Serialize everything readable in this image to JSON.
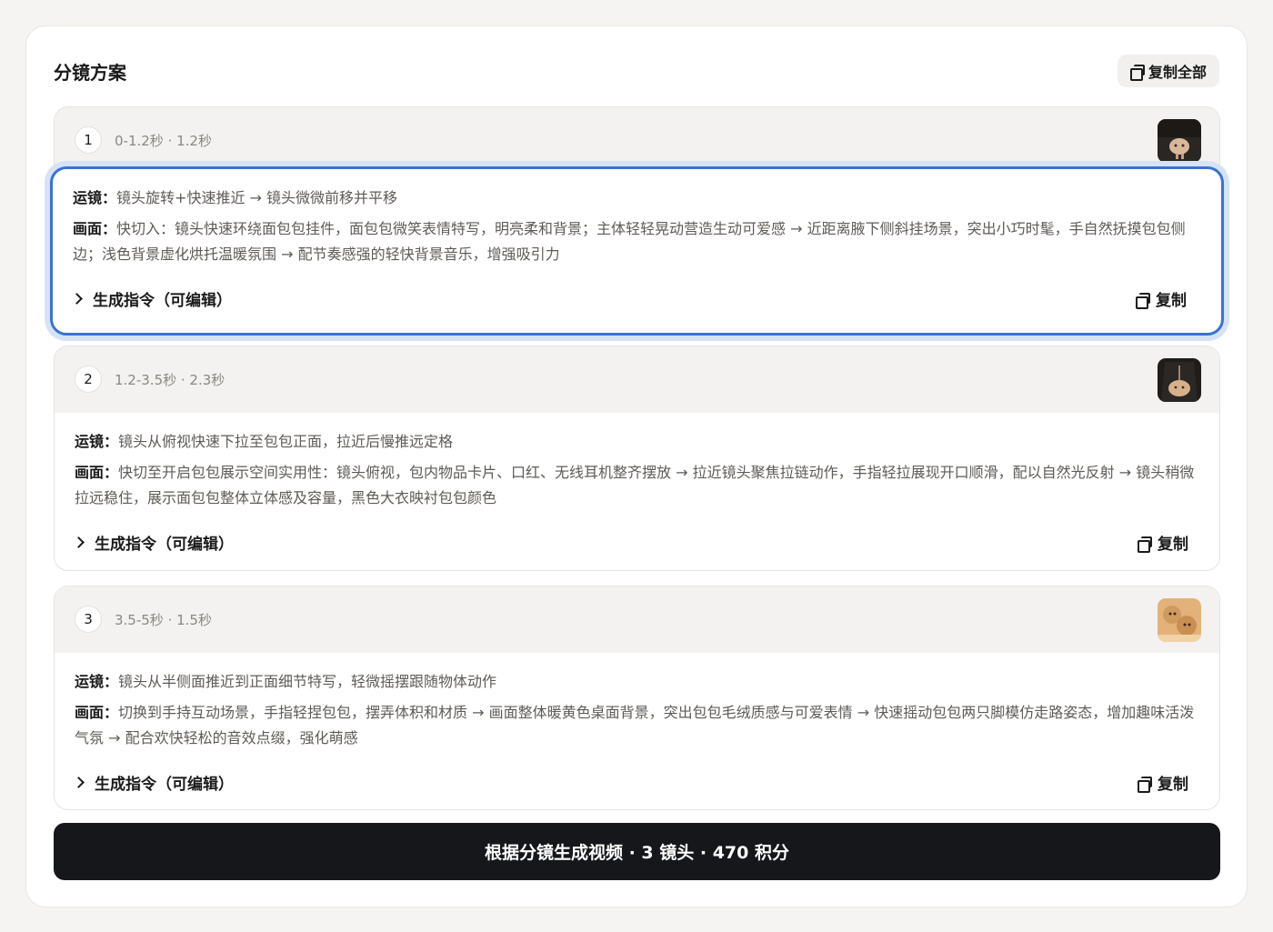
{
  "panel": {
    "title": "分镜方案",
    "copy_all_label": "复制全部"
  },
  "shots": [
    {
      "index": "1",
      "time": "0-1.2秒 · 1.2秒",
      "camera_label": "运镜",
      "camera": "镜头旋转+快速推近 → 镜头微微前移并平移",
      "scene_label": "画面",
      "scene": "快切入：镜头快速环绕面包包挂件，面包包微笑表情特写，明亮柔和背景；主体轻轻晃动营造生动可爱感 → 近距离腋下侧斜挂场景，突出小巧时髦，手自然抚摸包包侧边；浅色背景虚化烘托温暖氛围 → 配节奏感强的轻快背景音乐，增强吸引力",
      "prompt_label": "生成指令（可编辑）",
      "copy_label": "复制",
      "selected": true
    },
    {
      "index": "2",
      "time": "1.2-3.5秒 · 2.3秒",
      "camera_label": "运镜",
      "camera": "镜头从俯视快速下拉至包包正面，拉近后慢推远定格",
      "scene_label": "画面",
      "scene": "快切至开启包包展示空间实用性：镜头俯视，包内物品卡片、口红、无线耳机整齐摆放 → 拉近镜头聚焦拉链动作，手指轻拉展现开口顺滑，配以自然光反射 → 镜头稍微拉远稳住，展示面包包整体立体感及容量，黑色大衣映衬包包颜色",
      "prompt_label": "生成指令（可编辑）",
      "copy_label": "复制",
      "selected": false
    },
    {
      "index": "3",
      "time": "3.5-5秒 · 1.5秒",
      "camera_label": "运镜",
      "camera": "镜头从半侧面推近到正面细节特写，轻微摇摆跟随物体动作",
      "scene_label": "画面",
      "scene": "切换到手持互动场景，手指轻捏包包，摆弄体积和材质 → 画面整体暖黄色桌面背景，突出包包毛绒质感与可爱表情 → 快速摇动包包两只脚模仿走路姿态，增加趣味活泼气氛 → 配合欢快轻松的音效点缀，强化萌感",
      "prompt_label": "生成指令（可编辑）",
      "copy_label": "复制",
      "selected": false
    }
  ],
  "generate_button": "根据分镜生成视频 · 3 镜头 · 470 积分",
  "colors": {
    "accent": "#3a73d0",
    "button_bg": "#16171b",
    "header_bg": "#f3f2f0"
  }
}
